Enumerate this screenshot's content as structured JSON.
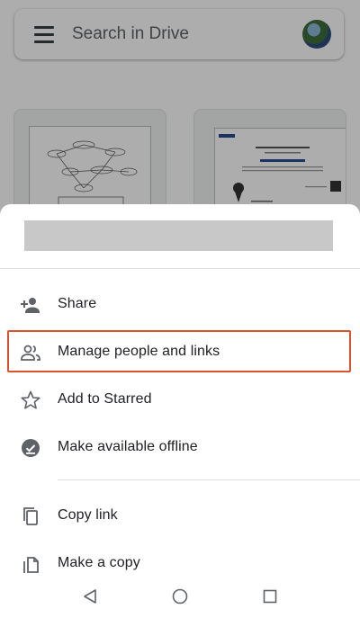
{
  "drive": {
    "search_placeholder": "Search in Drive"
  },
  "sheet": {
    "items": [
      {
        "label": "Share",
        "icon": "person-add-icon"
      },
      {
        "label": "Manage people and links",
        "icon": "people-icon",
        "highlighted": true
      },
      {
        "label": "Add to Starred",
        "icon": "star-outline-icon"
      },
      {
        "label": "Make available offline",
        "icon": "offline-check-icon"
      },
      {
        "label": "Copy link",
        "icon": "copy-icon"
      },
      {
        "label": "Make a copy",
        "icon": "file-copy-icon"
      }
    ]
  },
  "navbar": {
    "buttons": [
      "back-icon",
      "home-icon",
      "recents-icon"
    ]
  },
  "colors": {
    "highlight": "#d9542c",
    "icon": "#5f6368",
    "text": "#202124"
  }
}
